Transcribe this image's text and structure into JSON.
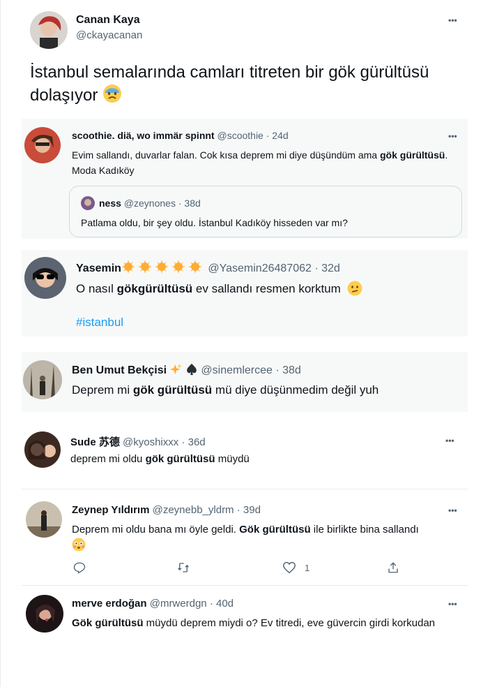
{
  "main": {
    "name": "Canan Kaya",
    "handle": "@ckayacanan",
    "text": "İstanbul semalarında camları titreten bir gök gürültüsü dolaşıyor"
  },
  "replies": [
    {
      "name": "scoothie. diä, wo immär spinnt",
      "handle": "@scoothie",
      "time": "· 24d",
      "text_before": "Evim sallandı, duvarlar falan. Cok kısa deprem mi diye düşündüm ama ",
      "text_bold": "gök gürültüsü",
      "text_after": ". Moda Kadıköy",
      "quote": {
        "name": "ness",
        "handle": "@zeynones",
        "time": "· 38d",
        "text": "Patlama oldu, bir şey oldu. İstanbul Kadıköy hisseden var mı?"
      }
    },
    {
      "name": "Yasemin",
      "handle": "@Yasemin26487062",
      "time": "· 32d",
      "text_before": "O nasıl ",
      "text_bold": "gökgürültüsü",
      "text_after": " ev sallandı resmen korktum",
      "hashtag": "#istanbul"
    },
    {
      "name": "Ben Umut Bekçisi",
      "handle": "@sinemlercee",
      "time": "· 38d",
      "text_before": "Deprem mi ",
      "text_bold": "gök gürültüsü",
      "text_after": " mü diye düşünmedim değil yuh"
    },
    {
      "name": "Sude 苏德",
      "handle": "@kyoshixxx",
      "time": "· 36d",
      "text_before": "deprem mi oldu ",
      "text_bold": "gök gürültüsü",
      "text_after": " müydü"
    },
    {
      "name": "Zeynep Yıldırım",
      "handle": "@zeynebb_yldrm",
      "time": "· 39d",
      "text_before": "Deprem mi oldu bana mı öyle geldi. ",
      "text_bold": "Gök gürültüsü",
      "text_after": " ile birlikte bina sallandı",
      "like_count": "1"
    },
    {
      "name": "merve erdoğan",
      "handle": "@mrwerdgn",
      "time": "· 40d",
      "text_bold": "Gök gürültüsü",
      "text_after": " müydü deprem miydi o? Ev titredi, eve güvercin girdi korkudan"
    }
  ],
  "more_glyph": "•••",
  "colors": {
    "accent": "#1d9bf0",
    "secondary": "#536471",
    "card_bg": "#f7f9f9",
    "star": "#ffac33"
  }
}
